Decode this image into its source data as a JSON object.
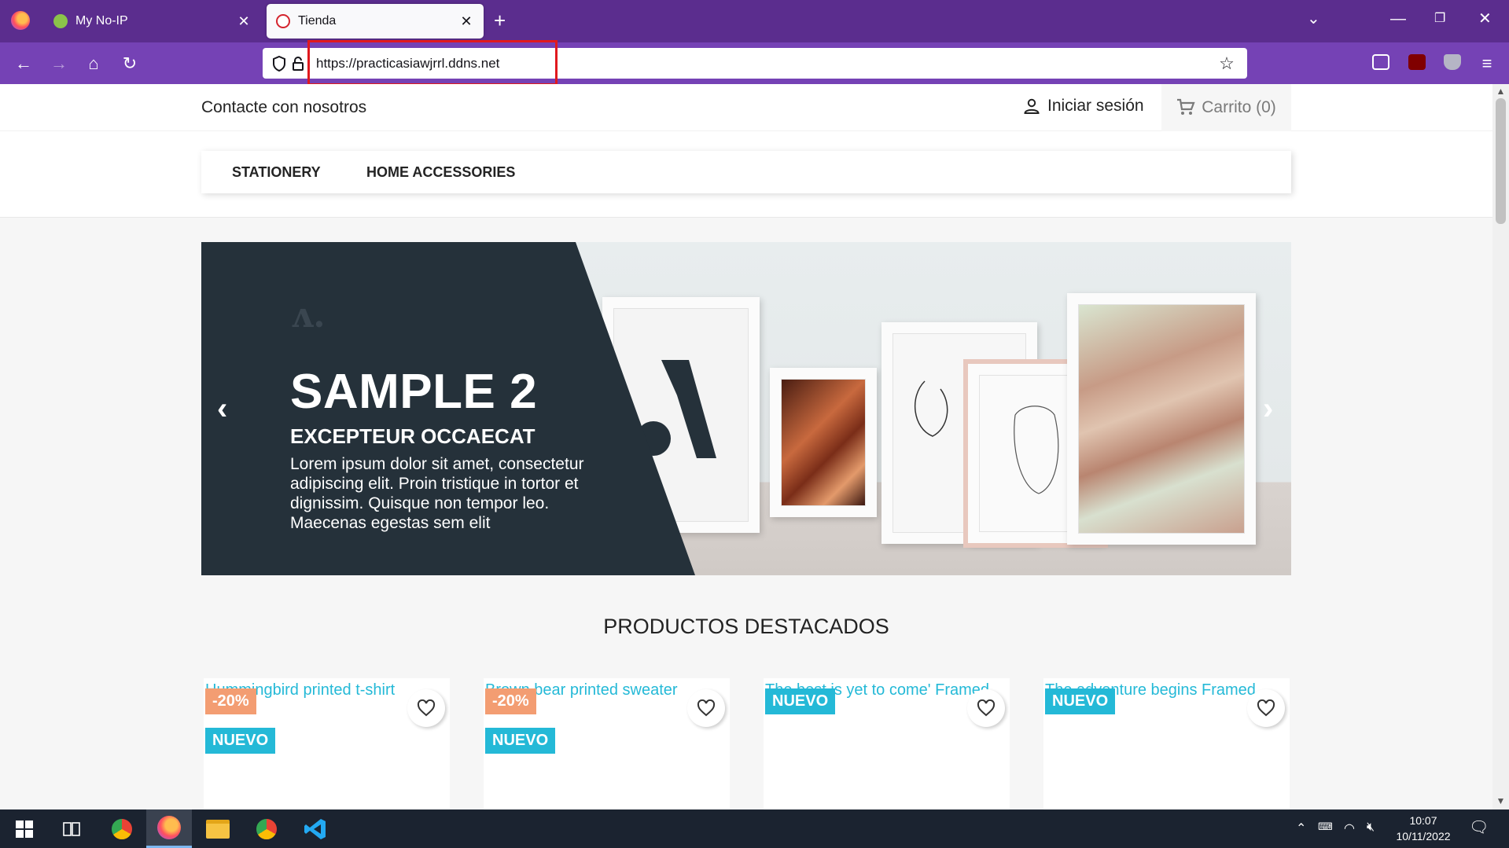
{
  "browser": {
    "tabs": [
      {
        "label": "My No-IP",
        "active": false
      },
      {
        "label": "Tienda",
        "active": true
      }
    ],
    "url": "https://practicasiawjrrl.ddns.net"
  },
  "header": {
    "contact": "Contacte con nosotros",
    "login": "Iniciar sesión",
    "cart": "Carrito (0)"
  },
  "menu": {
    "items": [
      "STATIONERY",
      "HOME ACCESSORIES"
    ]
  },
  "slider": {
    "title": "SAMPLE 2",
    "subtitle": "EXCEPTEUR OCCAECAT",
    "text": "Lorem ipsum dolor sit amet, consectetur adipiscing elit. Proin tristique in tortor et dignissim. Quisque non tempor leo. Maecenas egestas sem elit",
    "prev": "‹",
    "next": "›"
  },
  "featured": {
    "title": "PRODUCTOS DESTACADOS",
    "products": [
      {
        "name": "Hummingbird printed t-shirt",
        "discount": "-20%",
        "flag": "NUEVO"
      },
      {
        "name": "Brown bear printed sweater",
        "discount": "-20%",
        "flag": "NUEVO"
      },
      {
        "name": "The best is yet to come' Framed",
        "discount": "",
        "flag": "NUEVO"
      },
      {
        "name": "The adventure begins Framed",
        "discount": "",
        "flag": "NUEVO"
      }
    ]
  },
  "taskbar": {
    "time": "10:07",
    "date": "10/11/2022"
  },
  "colors": {
    "tabbar": "#5b2d8e",
    "navbar": "#7542b5",
    "accent": "#24b9d7",
    "discount": "#f39d72",
    "slide_dark": "#25313a",
    "highlight_box": "#e0191e"
  }
}
